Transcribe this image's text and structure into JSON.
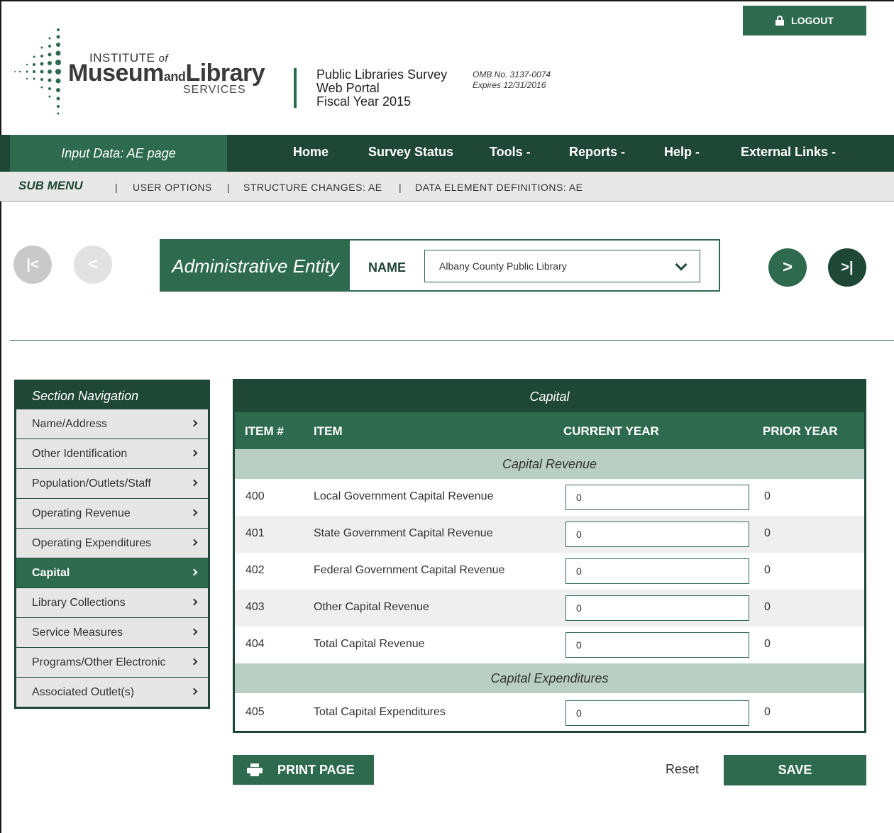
{
  "header": {
    "logo": {
      "institute": "INSTITUTE",
      "of": "of",
      "museum": "Museum",
      "and": "and",
      "library": "Library",
      "services": "SERVICES"
    },
    "survey_title_line1": "Public Libraries Survey",
    "survey_title_line2": "Web Portal",
    "survey_title_line3": "Fiscal Year 2015",
    "omb_line1": "OMB No. 3137-0074",
    "omb_line2": "Expires 12/31/2016",
    "logout_label": "LOGOUT"
  },
  "navbar": {
    "current_page": "Input Data: AE page",
    "items": [
      "Home",
      "Survey Status",
      "Tools -",
      "Reports -",
      "Help -",
      "External Links -"
    ]
  },
  "submenu": {
    "label": "SUB MENU",
    "separator": "|",
    "links": [
      "USER OPTIONS",
      "STRUCTURE CHANGES: AE",
      "DATA ELEMENT DEFINITIONS: AE"
    ]
  },
  "entity": {
    "title": "Administrative Entity",
    "name_label": "NAME",
    "selected_name": "Albany County Public Library",
    "nav_first": "|<",
    "nav_prev": "<",
    "nav_next": ">",
    "nav_last": ">|"
  },
  "section_nav": {
    "title": "Section Navigation",
    "items": [
      "Name/Address",
      "Other Identification",
      "Population/Outlets/Staff",
      "Operating Revenue",
      "Operating Expenditures",
      "Capital",
      "Library Collections",
      "Service Measures",
      "Programs/Other Electronic",
      "Associated Outlet(s)"
    ],
    "active": "Capital"
  },
  "capital": {
    "title": "Capital",
    "columns": [
      "ITEM #",
      "ITEM",
      "CURRENT YEAR",
      "PRIOR YEAR"
    ],
    "groups": [
      "Capital Revenue",
      "Capital Expenditures"
    ],
    "rows": [
      {
        "num": "400",
        "item": "Local Government Capital Revenue",
        "current": "0",
        "prior": "0"
      },
      {
        "num": "401",
        "item": "State Government Capital Revenue",
        "current": "0",
        "prior": "0"
      },
      {
        "num": "402",
        "item": "Federal Government Capital Revenue",
        "current": "0",
        "prior": "0"
      },
      {
        "num": "403",
        "item": "Other Capital Revenue",
        "current": "0",
        "prior": "0"
      },
      {
        "num": "404",
        "item": "Total Capital Revenue",
        "current": "0",
        "prior": "0"
      },
      {
        "num": "405",
        "item": "Total Capital Expenditures",
        "current": "0",
        "prior": "0"
      }
    ]
  },
  "actions": {
    "print_label": "PRINT PAGE",
    "reset_label": "Reset",
    "save_label": "SAVE"
  },
  "colors": {
    "brand_green": "#2e6b4e",
    "dark_green": "#1f4735",
    "group_row": "#b9cec4"
  }
}
